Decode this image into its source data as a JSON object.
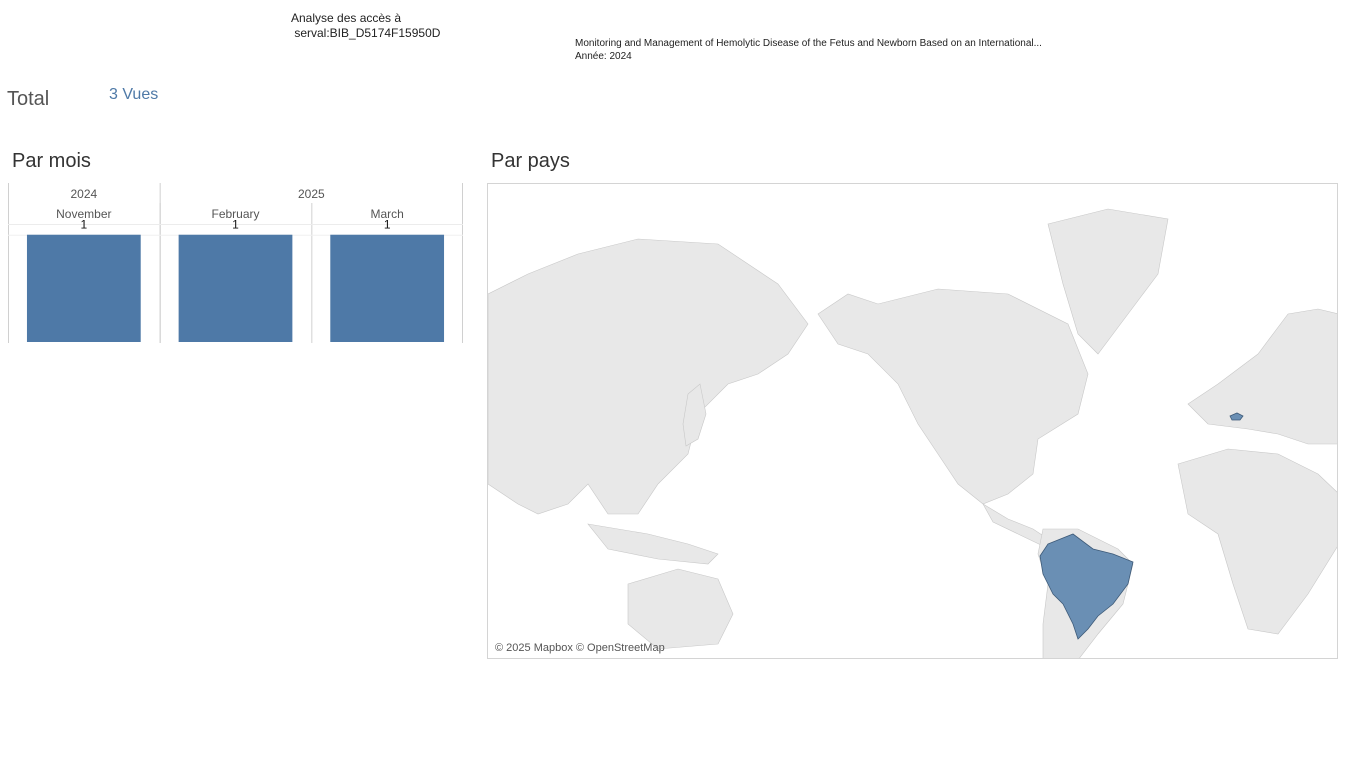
{
  "header": {
    "title_line1": "Analyse des accès à",
    "title_line2": " serval:BIB_D5174F15950D",
    "doc_title": "Monitoring and Management of Hemolytic Disease of the Fetus and Newborn Based on an International...",
    "doc_year": "Année: 2024"
  },
  "total": {
    "label": "Total",
    "value": "3 Vues"
  },
  "sections": {
    "by_month": "Par mois",
    "by_country": "Par pays"
  },
  "chart_data": {
    "type": "bar",
    "year_groups": [
      {
        "year": "2024",
        "months": [
          "November"
        ]
      },
      {
        "year": "2025",
        "months": [
          "February",
          "March"
        ]
      }
    ],
    "categories": [
      "November",
      "February",
      "March"
    ],
    "values": [
      1,
      1,
      1
    ],
    "ylim": [
      0,
      1.1
    ],
    "bar_color": "#4e79a7"
  },
  "map": {
    "credit": "© 2025 Mapbox © OpenStreetMap",
    "highlighted_countries": [
      "Brazil",
      "Switzerland"
    ],
    "highlight_color": "#6a8fb4",
    "land_color": "#e6e6e6"
  }
}
